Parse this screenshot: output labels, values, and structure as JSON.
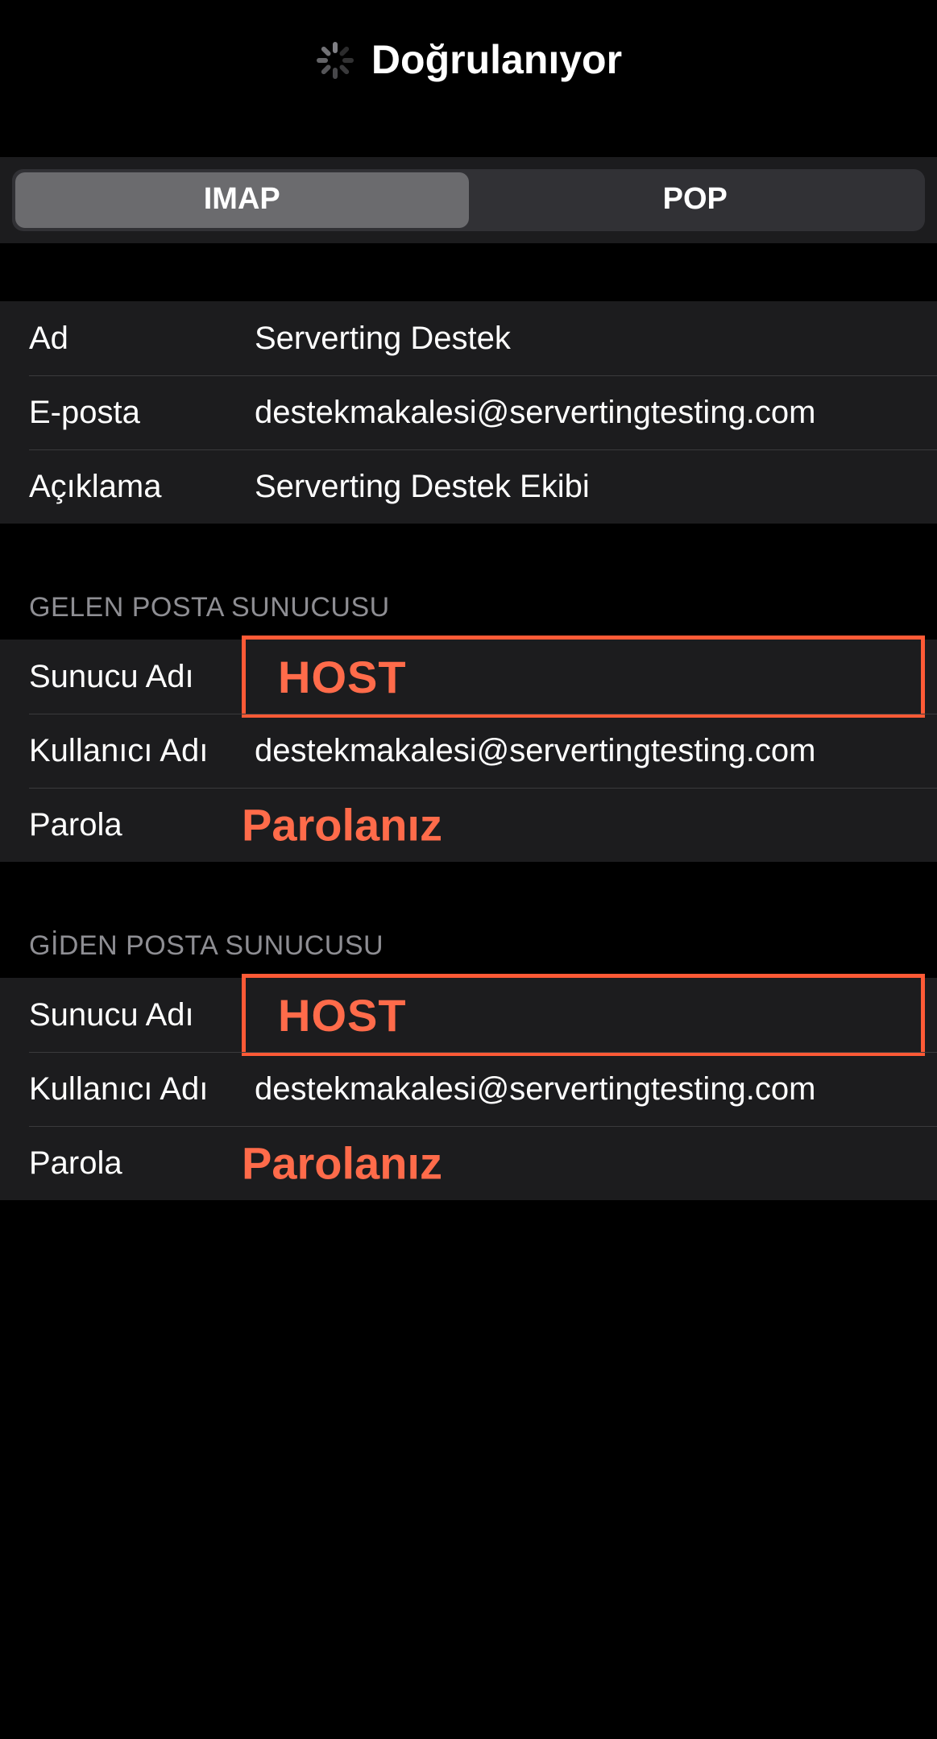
{
  "header": {
    "title": "Doğrulanıyor"
  },
  "segments": {
    "imap": "IMAP",
    "pop": "POP"
  },
  "account": {
    "name_label": "Ad",
    "name_value": "Serverting Destek",
    "email_label": "E-posta",
    "email_value": "destekmakalesi@servertingtesting.com",
    "desc_label": "Açıklama",
    "desc_value": "Serverting Destek Ekibi"
  },
  "incoming": {
    "header": "GELEN POSTA SUNUCUSU",
    "host_label": "Sunucu Adı",
    "host_annotation": "HOST",
    "user_label": "Kullanıcı Adı",
    "user_value": "destekmakalesi@servertingtesting.com",
    "pass_label": "Parola",
    "pass_annotation": "Parolanız"
  },
  "outgoing": {
    "header": "GİDEN POSTA SUNUCUSU",
    "host_label": "Sunucu Adı",
    "host_annotation": "HOST",
    "user_label": "Kullanıcı Adı",
    "user_value": "destekmakalesi@servertingtesting.com",
    "pass_label": "Parola",
    "pass_annotation": "Parolanız"
  }
}
